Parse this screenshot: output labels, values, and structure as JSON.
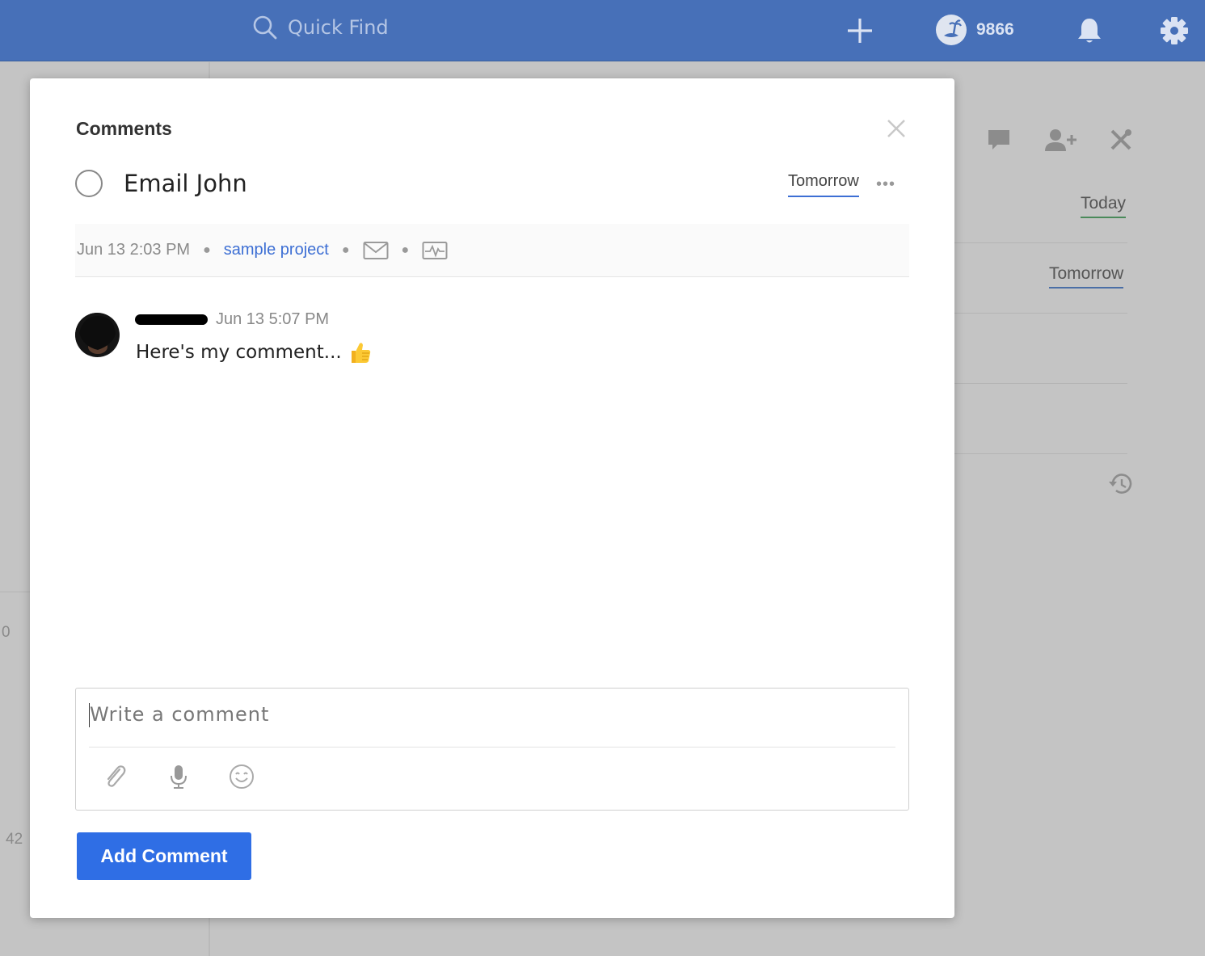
{
  "topbar": {
    "search_placeholder": "Quick Find",
    "karma_points": "9866"
  },
  "background": {
    "left_numbers": [
      "0",
      "42"
    ],
    "dates": [
      "Today",
      "Tomorrow"
    ]
  },
  "modal": {
    "title": "Comments",
    "task": {
      "name": "Email John",
      "due": "Tomorrow",
      "more": "•••"
    },
    "meta": {
      "created": "Jun 13 2:03 PM",
      "project": "sample project"
    },
    "comment": {
      "time": "Jun 13 5:07 PM",
      "text": "Here's my comment..."
    },
    "editor": {
      "placeholder": "Write a comment"
    },
    "submit_label": "Add Comment"
  },
  "colors": {
    "topbar": "#4770b8",
    "accent": "#2f6ee5",
    "link": "#3d6fd4"
  }
}
